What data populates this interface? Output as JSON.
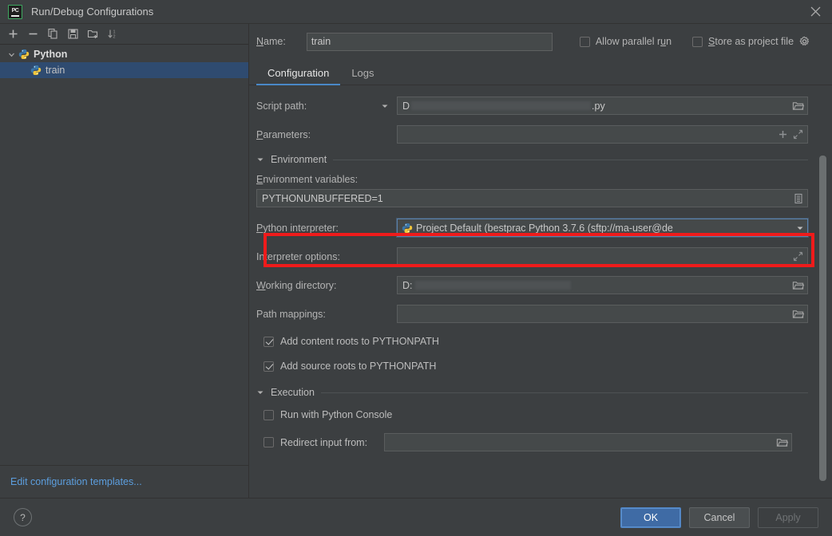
{
  "window": {
    "title": "Run/Debug Configurations",
    "app_icon": "pycharm-icon",
    "close_icon": "close-icon"
  },
  "sidebar": {
    "toolbar": [
      {
        "name": "add-configuration-button",
        "icon": "plus-icon",
        "label": "+"
      },
      {
        "name": "remove-configuration-button",
        "icon": "minus-icon",
        "label": "−"
      },
      {
        "name": "copy-configuration-button",
        "icon": "copy-icon",
        "label": ""
      },
      {
        "name": "save-configuration-button",
        "icon": "save-icon",
        "label": ""
      },
      {
        "name": "move-into-folder-button",
        "icon": "folder-add-icon",
        "label": ""
      },
      {
        "name": "sort-configurations-button",
        "icon": "sort-az-icon",
        "label": ""
      }
    ],
    "tree": [
      {
        "label": "Python",
        "type": "group",
        "expanded": true,
        "icon": "python-icon"
      },
      {
        "label": "train",
        "type": "item",
        "selected": true,
        "icon": "python-icon"
      }
    ],
    "footer_link": "Edit configuration templates..."
  },
  "header": {
    "name_label": "Name:",
    "name_mnemonic": "N",
    "name_value": "train",
    "allow_parallel_run": {
      "label_before": "Allow parallel r",
      "mnemonic": "u",
      "label_after": "n",
      "checked": false
    },
    "store_as_project_file": {
      "mnemonic": "S",
      "label_after": "tore as project file",
      "checked": false
    },
    "gear_icon": "gear-icon"
  },
  "tabs": [
    {
      "label": "Configuration",
      "active": true
    },
    {
      "label": "Logs",
      "active": false
    }
  ],
  "form": {
    "script_path": {
      "label": "Script path:",
      "value_prefix": "D",
      "value_suffix": ".py",
      "redacted": true,
      "browse_icon": "folder-icon",
      "dropdown_icon": "chevron-down-icon"
    },
    "parameters": {
      "label": "Parameters:",
      "mnemonic": "P",
      "label_rest": "arameters:",
      "value": "",
      "add_icon": "plus-icon",
      "expand_icon": "expand-icon"
    },
    "environment_section": {
      "title": "Environment",
      "expanded": true,
      "collapse_icon": "triangle-down-icon"
    },
    "environment_variables": {
      "label": "Environment variables:",
      "mnemonic": "E",
      "label_rest": "nvironment variables:",
      "value": "PYTHONUNBUFFERED=1",
      "edit_icon": "list-edit-icon"
    },
    "python_interpreter": {
      "label": "Python interpreter:",
      "mnemonic": "P",
      "label_rest": "ython interpreter:",
      "value": "Project Default (bestprac Python 3.7.6 (sftp://ma-user@de",
      "icon": "python-icon",
      "dropdown_icon": "chevron-down-icon",
      "highlighted": true,
      "highlight_color": "#ef1b1b"
    },
    "interpreter_options": {
      "label": "Interpreter options:",
      "value": "",
      "expand_icon": "expand-icon"
    },
    "working_directory": {
      "label": "Working directory:",
      "mnemonic": "W",
      "label_rest": "orking directory:",
      "value_prefix": "D:",
      "redacted": true,
      "browse_icon": "folder-icon"
    },
    "path_mappings": {
      "label": "Path mappings:",
      "value": "",
      "browse_icon": "folder-icon"
    },
    "add_content_roots": {
      "label": "Add content roots to PYTHONPATH",
      "checked": true
    },
    "add_source_roots": {
      "label": "Add source roots to PYTHONPATH",
      "checked": true
    },
    "execution_section": {
      "title": "Execution",
      "expanded": true,
      "collapse_icon": "triangle-down-icon"
    },
    "run_with_python_console": {
      "label": "Run with Python Console",
      "checked": false
    },
    "redirect_input_from": {
      "label": "Redirect input from:",
      "checked": false,
      "value": "",
      "browse_icon": "folder-icon"
    }
  },
  "footer": {
    "help_label": "?",
    "ok_label": "OK",
    "cancel_label": "Cancel",
    "apply_label": "Apply",
    "apply_enabled": false
  },
  "colors": {
    "background": "#3c3f41",
    "field_background": "#45494a",
    "accent_blue": "#4a88c7",
    "primary_button": "#3f6ba5",
    "selection": "#2f4b70",
    "link": "#5c9ede",
    "annotation_red": "#ef1b1b"
  }
}
